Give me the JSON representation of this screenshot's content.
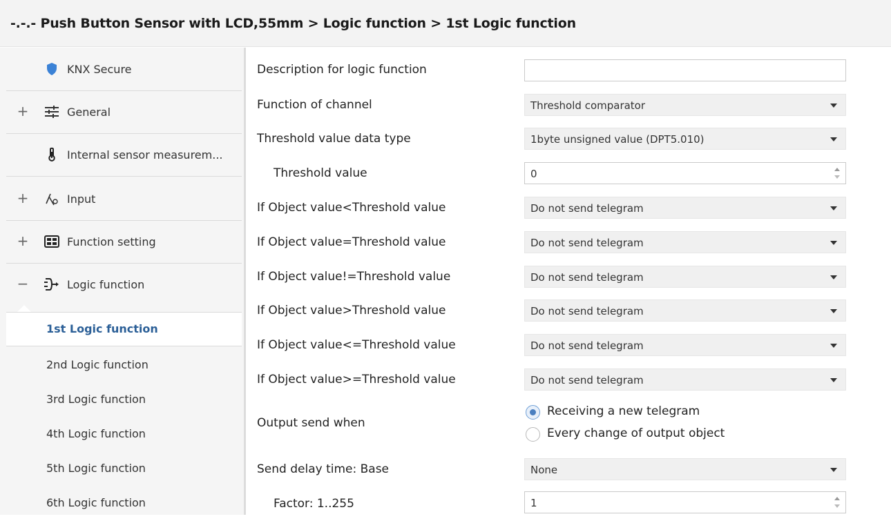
{
  "breadcrumb": "-.-.- Push Button Sensor with LCD,55mm > Logic function > 1st Logic function",
  "sidebar": {
    "items": [
      {
        "expander": "",
        "icon": "shield-icon",
        "label": "KNX Secure"
      },
      {
        "expander": "+",
        "icon": "sliders-icon",
        "label": "General"
      },
      {
        "expander": "",
        "icon": "thermometer-icon",
        "label": "Internal sensor measurem..."
      },
      {
        "expander": "+",
        "icon": "input-icon",
        "label": "Input"
      },
      {
        "expander": "+",
        "icon": "grid-icon",
        "label": "Function setting"
      },
      {
        "expander": "−",
        "icon": "logic-icon",
        "label": "Logic function"
      }
    ],
    "subitems": [
      {
        "label": "1st Logic function",
        "active": true
      },
      {
        "label": "2nd Logic function"
      },
      {
        "label": "3rd Logic function"
      },
      {
        "label": "4th Logic function"
      },
      {
        "label": "5th Logic function"
      },
      {
        "label": "6th Logic function"
      }
    ]
  },
  "form": {
    "description": {
      "label": "Description for logic function",
      "value": ""
    },
    "function_of_channel": {
      "label": "Function of channel",
      "value": "Threshold comparator"
    },
    "threshold_data_type": {
      "label": "Threshold value data type",
      "value": "1byte unsigned value (DPT5.010)"
    },
    "threshold_value": {
      "label": "Threshold value",
      "value": "0"
    },
    "if_less": {
      "label": "If Object value<Threshold value",
      "value": "Do not send telegram"
    },
    "if_equal": {
      "label": "If Object value=Threshold value",
      "value": "Do not send telegram"
    },
    "if_not_equal": {
      "label": "If Object value!=Threshold value",
      "value": "Do not send telegram"
    },
    "if_greater": {
      "label": "If Object value>Threshold value",
      "value": "Do not send telegram"
    },
    "if_less_equal": {
      "label": "If Object value<=Threshold value",
      "value": "Do not send telegram"
    },
    "if_greater_equal": {
      "label": "If Object value>=Threshold value",
      "value": "Do not send telegram"
    },
    "output_send_when": {
      "label": "Output send when",
      "options": [
        "Receiving a new telegram",
        "Every change of output object"
      ],
      "selected": "Receiving a new telegram"
    },
    "send_delay_base": {
      "label": "Send delay time: Base",
      "value": "None"
    },
    "factor": {
      "label": "Factor: 1..255",
      "value": "1"
    }
  },
  "colors": {
    "accent": "#2b5f97",
    "shield": "#3b82d6"
  }
}
